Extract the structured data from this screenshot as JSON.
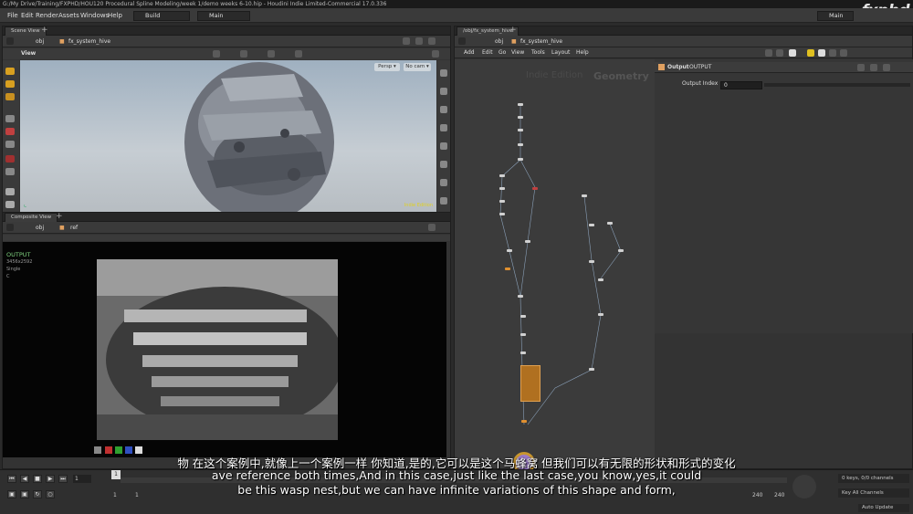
{
  "window": {
    "title": "G:/My Drive/Training/FXPHD/HOU120 Procedural Spline Modeling/week 1/demo weeks 6-10.hip - Houdini Indie Limited-Commercial 17.0.336",
    "logo": "fxphd"
  },
  "menu": {
    "items": [
      "File",
      "Edit",
      "Render",
      "Assets",
      "Windows",
      "Help"
    ],
    "desktop": "Build",
    "update_mode": "Main",
    "right_label": "Main"
  },
  "scene_view": {
    "tab": "Scene View",
    "path_root": "obj",
    "path_node": "fx_system_hive",
    "viewport_label": "View",
    "persp": "Persp ▾",
    "cam": "No cam ▾",
    "indie_tag": "Indie Edition"
  },
  "composite_view": {
    "tab": "Composite View",
    "path_root": "obj",
    "path_node": "ref",
    "info_name": "OUTPUT",
    "info_res": "3456x2592",
    "info_mode": "Single",
    "info_ch": "C"
  },
  "network": {
    "tab": "/obj/fx_system_hive",
    "path_root": "obj",
    "path_node": "fx_system_hive",
    "menu": [
      "Add",
      "Edit",
      "Go",
      "View",
      "Tools",
      "Layout",
      "Help"
    ],
    "watermark_indie": "Indie Edition",
    "watermark_geo": "Geometry"
  },
  "params": {
    "node_type": "Output",
    "node_name": "OUTPUT",
    "field_label": "Output Index",
    "field_value": "0"
  },
  "timeline": {
    "frame": "1",
    "start": "1",
    "start2": "1",
    "end": "240",
    "end2": "240",
    "key_status": "0 keys, 0/0 channels",
    "key_all": "Key All Channels",
    "auto_update": "Auto Update"
  },
  "subtitles": {
    "line_cn": "物 在这个案例中,就像上一个案例一样 你知道,是的,它可以是这个马蜂窝 但我们可以有无限的形状和形式的变化",
    "line_en1": "ave reference both times,And in this case,just like the last case,you know,yes,it could",
    "line_en2": "be this wasp nest,but we can have infinite variations of this shape and form,"
  }
}
